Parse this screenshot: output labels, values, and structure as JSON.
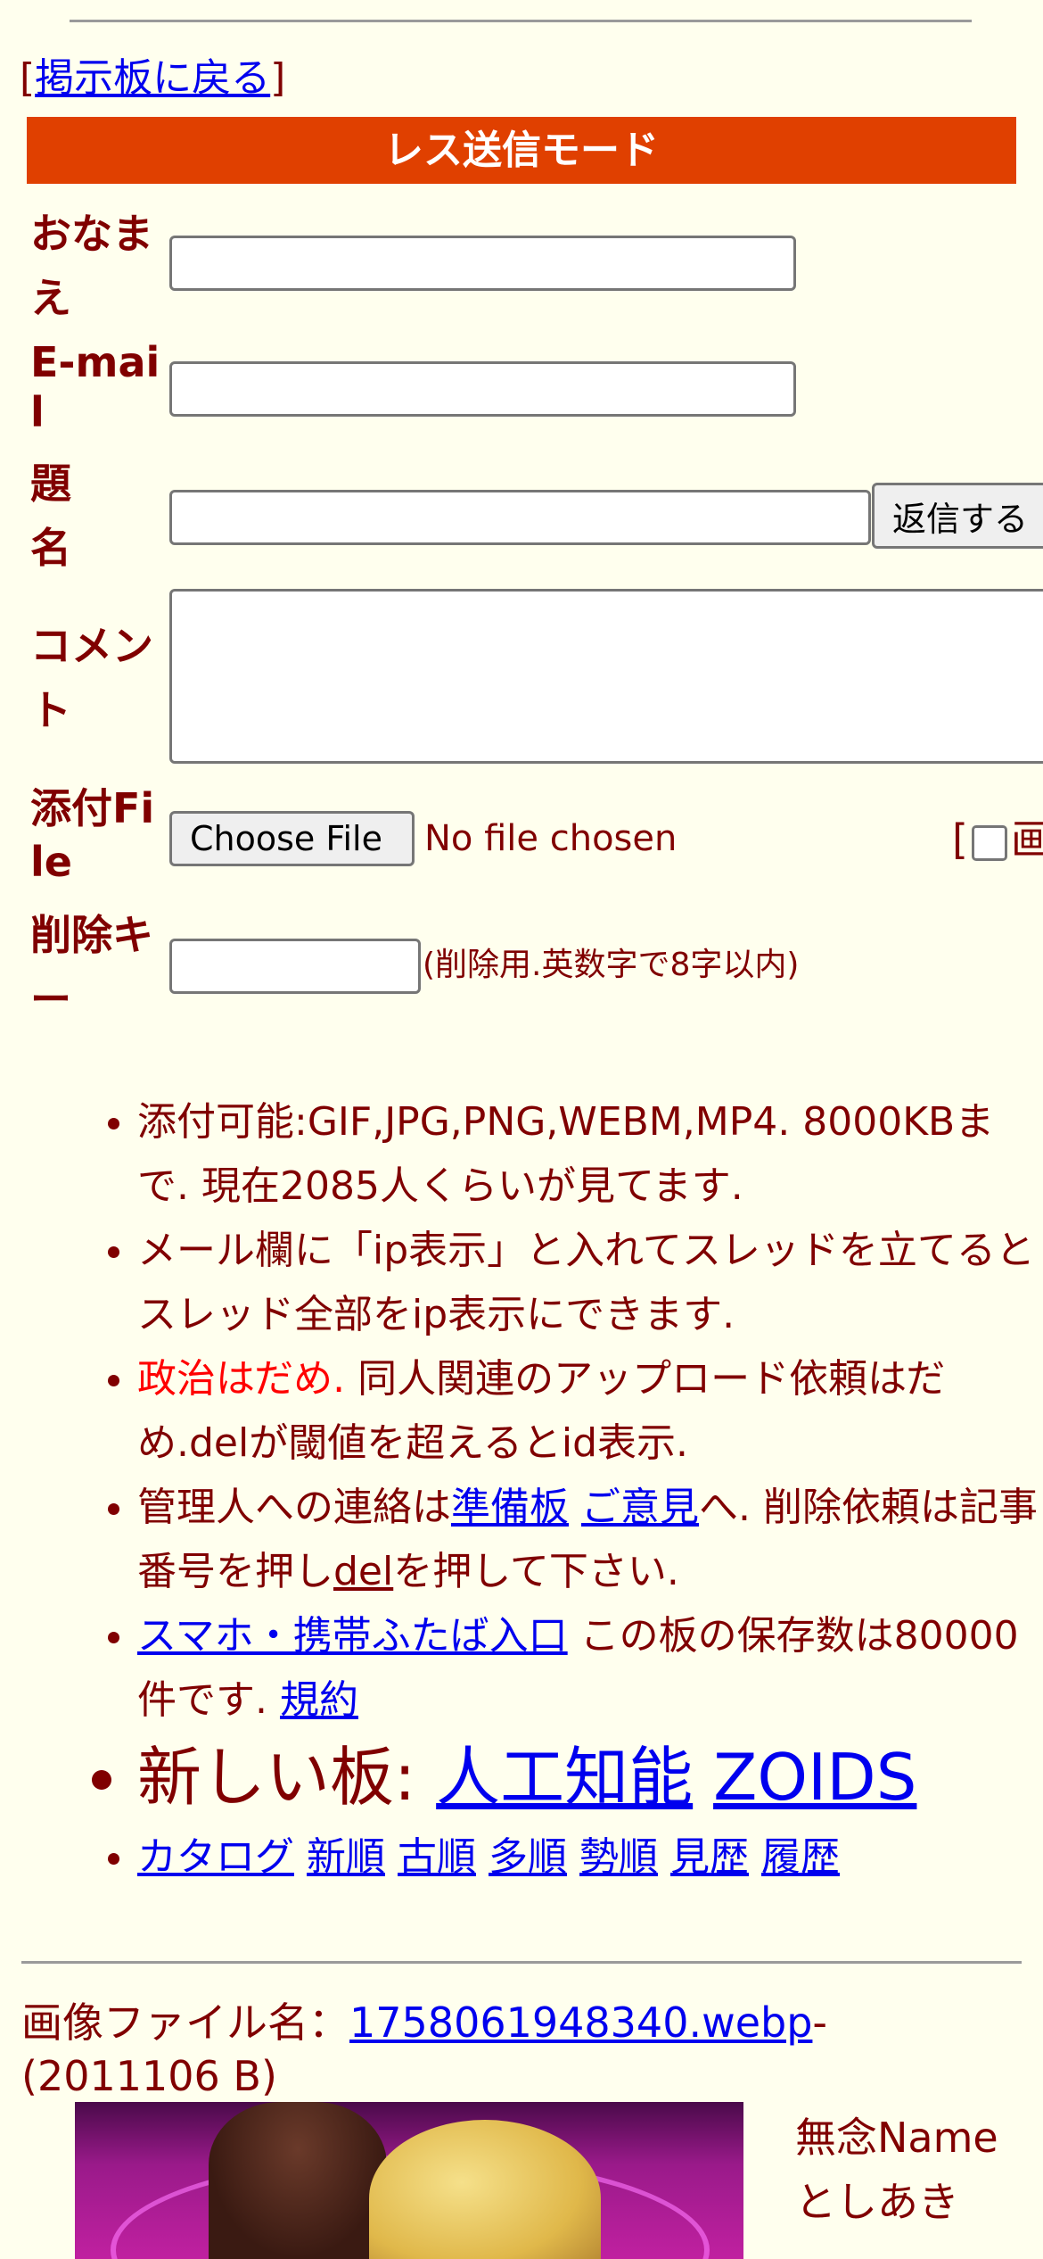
{
  "header": {
    "back_open": "[",
    "back_link": "掲示板に戻る",
    "back_close": "]"
  },
  "form": {
    "mode_title": "レス送信モード",
    "name_label": "おなまえ",
    "email_label": "E-mail",
    "subject_label": "題名",
    "submit_label": "返信する",
    "comment_label": "コメント",
    "attach_label": "添付File",
    "choose_file": "Choose File",
    "no_file": "No file chosen",
    "image_option_open": "[",
    "image_option_text": "画",
    "delkey_label": "削除キー",
    "delkey_hint": "(削除用.英数字で8字以内)"
  },
  "notes": {
    "n1": "添付可能:GIF,JPG,PNG,WEBM,MP4. 8000KBまで. 現在2085人くらいが見てます.",
    "n2": "メール欄に「ip表示」と入れてスレッドを立てるとスレッド全部をip表示にできます.",
    "n3_red": "政治はだめ.",
    "n3_rest": " 同人関連のアップロード依頼はだめ.delが閾値を超えるとid表示.",
    "n4_a": "管理人への連絡は",
    "n4_link1": "準備板",
    "n4_link2": "ご意見",
    "n4_b": "へ. 削除依頼は記事番号を押し",
    "n4_del": "del",
    "n4_c": "を押して下さい.",
    "n5_link": "スマホ・携帯ふたば入口",
    "n5_text": " この板の保存数は80000件です. ",
    "n5_rules": "規約",
    "n6_prefix": "新しい板: ",
    "n6_link1": "人工知能",
    "n6_link2": "ZOIDS",
    "sort": [
      "カタログ",
      "新順",
      "古順",
      "多順",
      "勢順",
      "見歴",
      "履歴"
    ]
  },
  "post": {
    "file_label": "画像ファイル名：",
    "file_name": "1758061948340.webp",
    "file_size": "-(2011106 B)",
    "poster_name": "無念Name",
    "poster_sub": "としあき"
  },
  "colors": {
    "background": "#ffffee",
    "text": "#800000",
    "mode_bar": "#e04000",
    "link": "#0000ee",
    "warning": "#ff0000"
  }
}
